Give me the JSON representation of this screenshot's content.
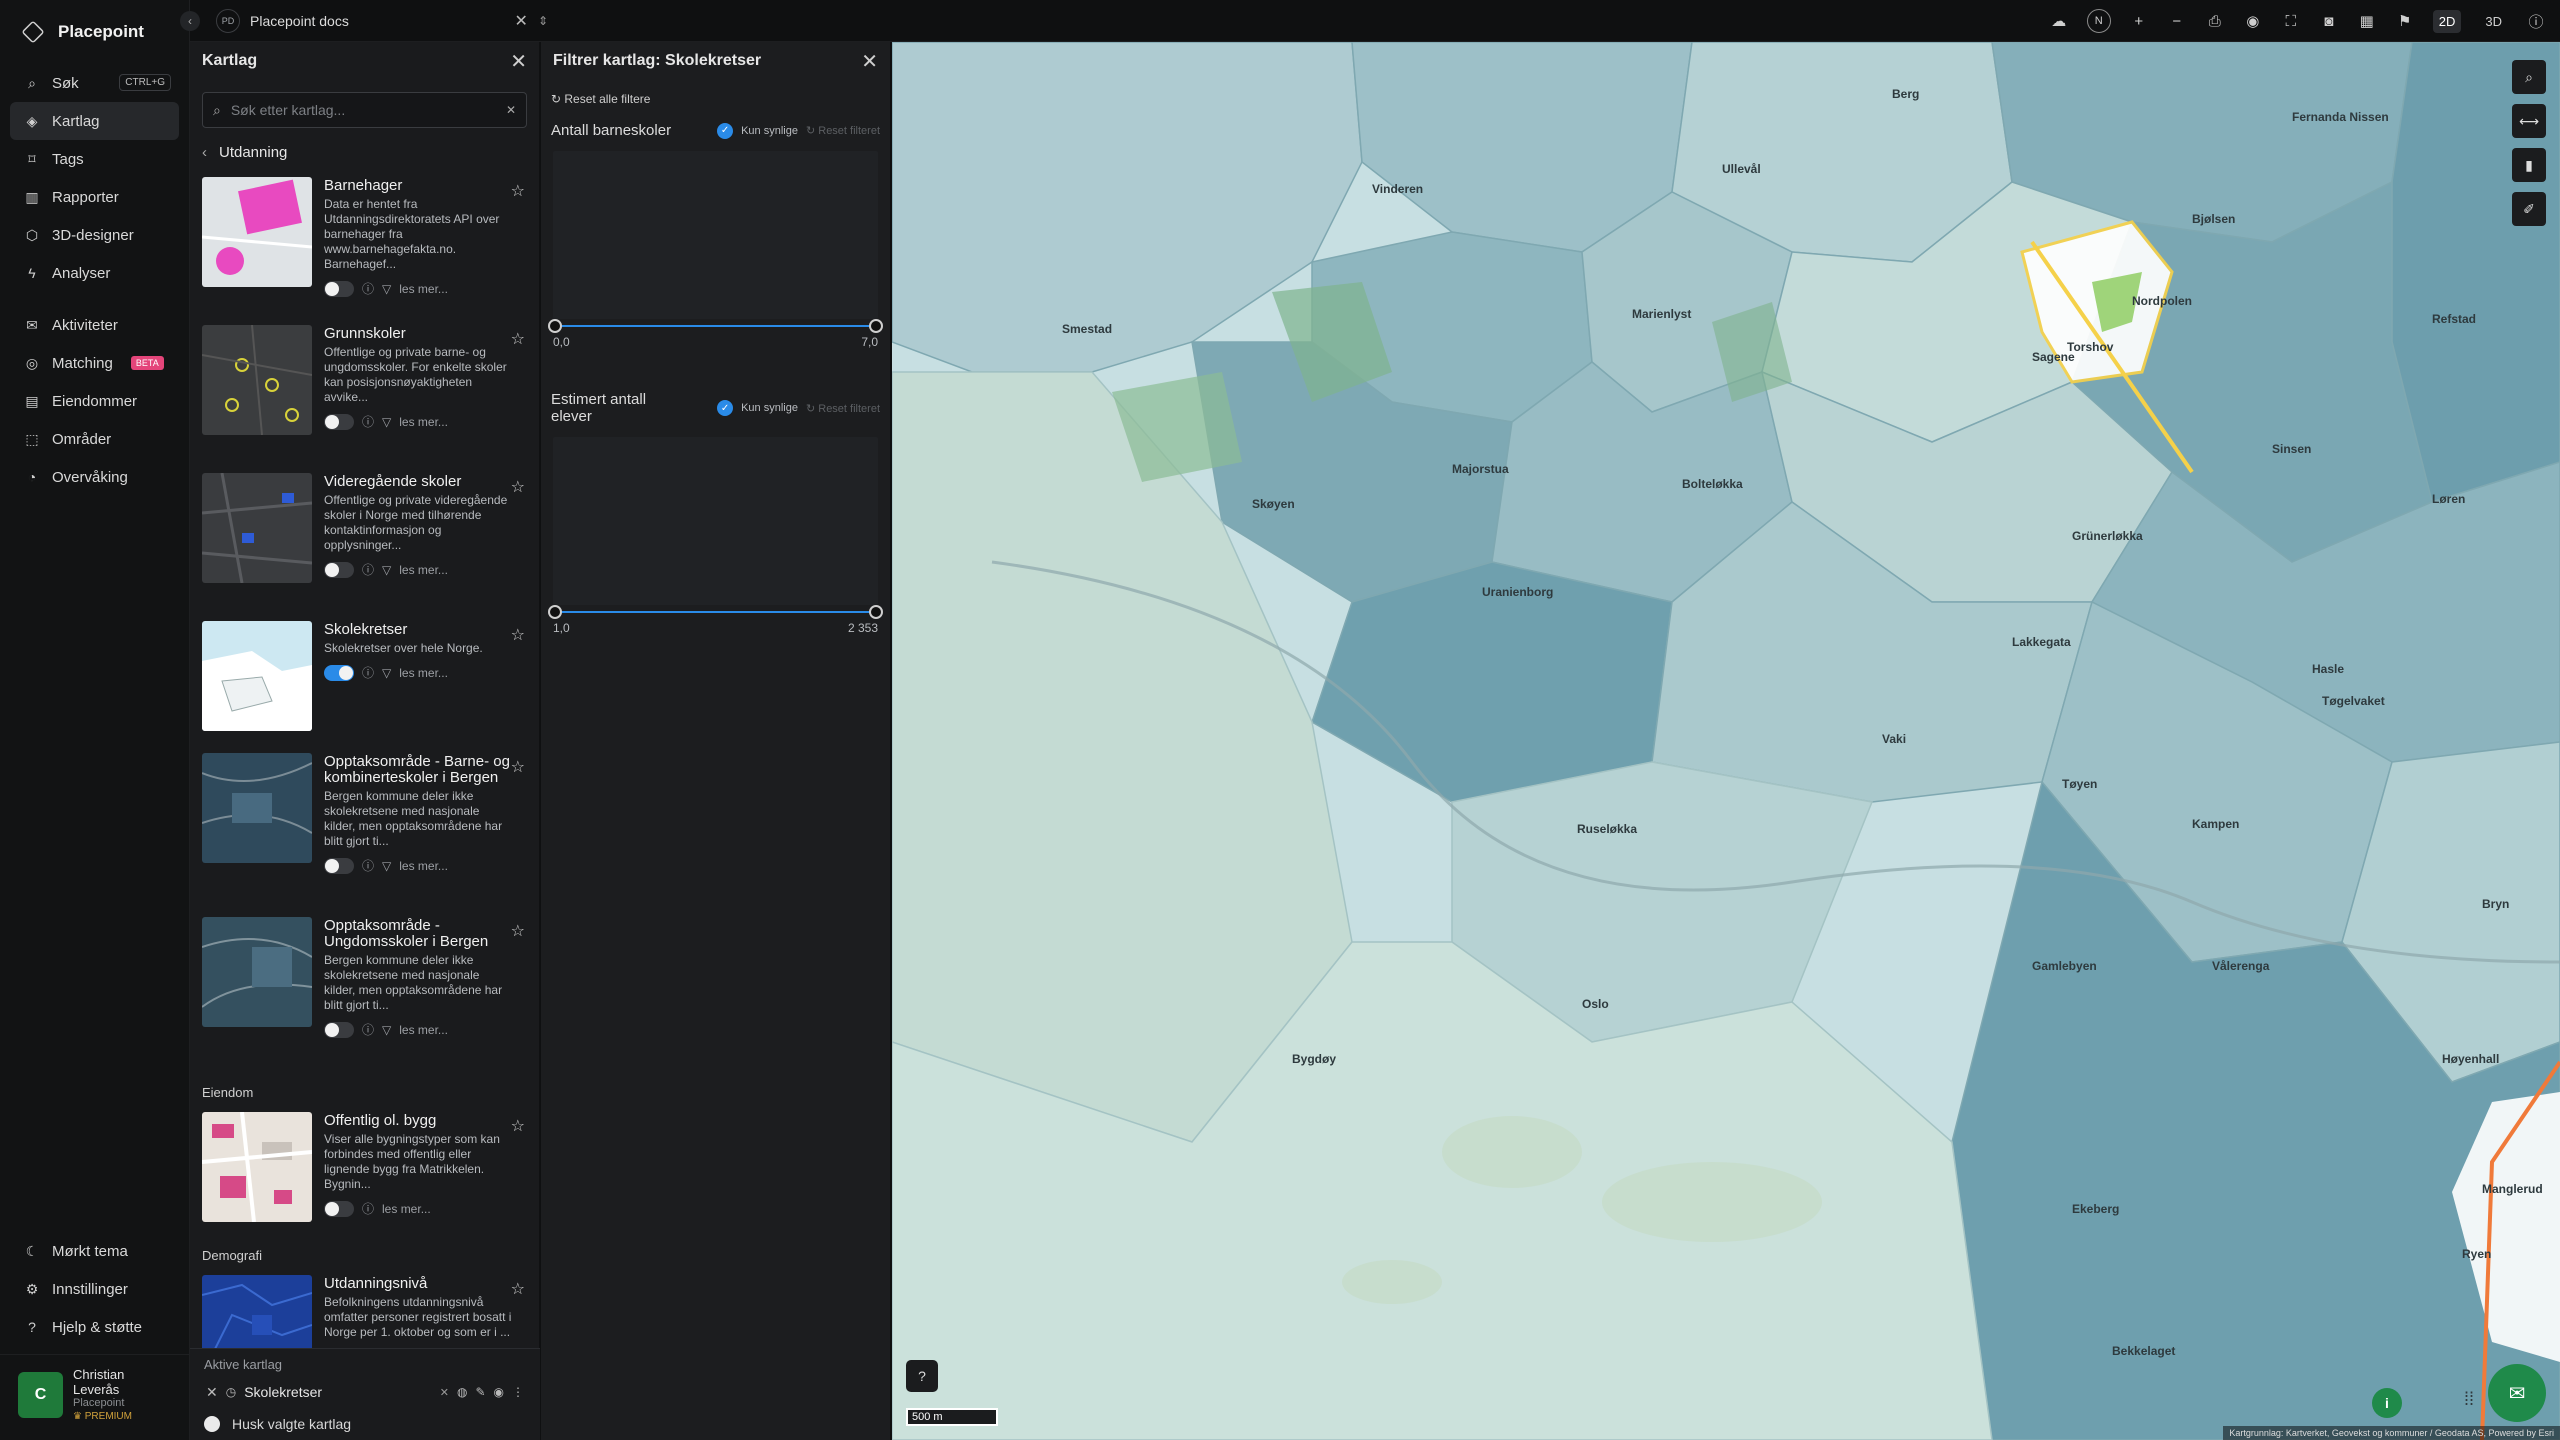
{
  "app": {
    "name": "Placepoint",
    "doc_badge": "PD",
    "doc_title": "Placepoint docs"
  },
  "nav": {
    "items": [
      {
        "label": "Søk",
        "icon": "search-icon",
        "shortcut": "CTRL+G"
      },
      {
        "label": "Kartlag",
        "icon": "layers-icon",
        "active": true
      },
      {
        "label": "Tags",
        "icon": "tag-icon"
      },
      {
        "label": "Rapporter",
        "icon": "chart-icon"
      },
      {
        "label": "3D-designer",
        "icon": "cube-icon"
      },
      {
        "label": "Analyser",
        "icon": "bolt-icon"
      }
    ],
    "items2": [
      {
        "label": "Aktiviteter",
        "icon": "activity-icon"
      },
      {
        "label": "Matching",
        "icon": "matching-icon",
        "badge": "BETA"
      },
      {
        "label": "Eiendommer",
        "icon": "building-icon"
      },
      {
        "label": "Områder",
        "icon": "area-icon"
      },
      {
        "label": "Overvåking",
        "icon": "monitor-icon"
      }
    ],
    "bottom": [
      {
        "label": "Mørkt tema",
        "icon": "moon-icon"
      },
      {
        "label": "Innstillinger",
        "icon": "gear-icon"
      },
      {
        "label": "Hjelp & støtte",
        "icon": "help-icon"
      }
    ],
    "user": {
      "initial": "C",
      "name": "Christian Leverås",
      "org": "Placepoint",
      "plan": "PREMIUM"
    }
  },
  "toolbar": {
    "modes": [
      "2D",
      "3D"
    ],
    "active_mode": "2D",
    "compass": "N"
  },
  "layers_panel": {
    "title": "Kartlag",
    "search_placeholder": "Søk etter kartlag...",
    "breadcrumb": "Utdanning",
    "more_label": "les mer...",
    "layers": [
      {
        "title": "Barnehager",
        "desc": "Data er hentet fra Utdanningsdirektoratets API over barnehager fra www.barnehagefakta.no. Barnehagef...",
        "on": false
      },
      {
        "title": "Grunnskoler",
        "desc": "Offentlige og private barne- og ungdomsskoler. For enkelte skoler kan posisjonsnøyaktigheten avvike...",
        "on": false
      },
      {
        "title": "Videregående skoler",
        "desc": "Offentlige og private videregående skoler i Norge med tilhørende kontaktinformasjon og opplysninger...",
        "on": false
      },
      {
        "title": "Skolekretser",
        "desc": "Skolekretser over hele Norge.",
        "on": true
      },
      {
        "title": "Opptaksområde - Barne- og kombinerteskoler i Bergen",
        "desc": "Bergen kommune deler ikke skolekretsene med nasjonale kilder, men opptaksområdene har blitt gjort ti...",
        "on": false
      },
      {
        "title": "Opptaksområde - Ungdomsskoler i Bergen",
        "desc": "Bergen kommune deler ikke skolekretsene med nasjonale kilder, men opptaksområdene har blitt gjort ti...",
        "on": false
      }
    ],
    "section_eiendom": "Eiendom",
    "eiendom_layer": {
      "title": "Offentlig ol. bygg",
      "desc": "Viser alle bygningstyper som kan forbindes med offentlig eller lignende bygg fra Matrikkelen. Bygnin...",
      "on": false
    },
    "section_demografi": "Demografi",
    "demografi_layer": {
      "title": "Utdanningsnivå",
      "desc": "Befolkningens utdanningsnivå omfatter personer registrert bosatt i Norge per 1. oktober og som er i ..."
    },
    "active_title": "Aktive kartlag",
    "active_layer": "Skolekretser",
    "remember_label": "Husk valgte kartlag"
  },
  "filter_panel": {
    "title": "Filtrer kartlag: Skolekretser",
    "reset_all": "Reset alle filtere",
    "only_visible": "Kun synlige",
    "reset_filter": "Reset filteret",
    "filters": [
      {
        "label": "Antall barneskoler",
        "min": "0,0",
        "max": "7,0"
      },
      {
        "label": "Estimert antall elever",
        "min": "1,0",
        "max": "2 353"
      }
    ]
  },
  "map": {
    "scale": "500 m",
    "attribution": "Kartgrunnlag: Kartverket, Geovekst og kommuner / Geodata AS, Powered by Esri",
    "labels": [
      "Vinderen",
      "Ullevål",
      "Smestad",
      "Marienlyst",
      "Torshov",
      "Nordpolen",
      "Sagene",
      "Bjølsen",
      "Refstad",
      "Sinsen",
      "Majorstua",
      "Bolteløkka",
      "Skøyen",
      "Grünerløkka",
      "Løren",
      "Uranienborg",
      "Lakkegata",
      "Hasle",
      "Tøyen",
      "Vaki",
      "Ruseløkka",
      "Tøgelvaket",
      "Kampen",
      "Gamlebyen",
      "Vålerenga",
      "Bryn",
      "Oslo",
      "Bygdøy",
      "Høyenhall",
      "Ekeberg",
      "Manglerud",
      "Ryen",
      "Bekkelaget",
      "Fernanda Nissen",
      "Berg"
    ]
  }
}
